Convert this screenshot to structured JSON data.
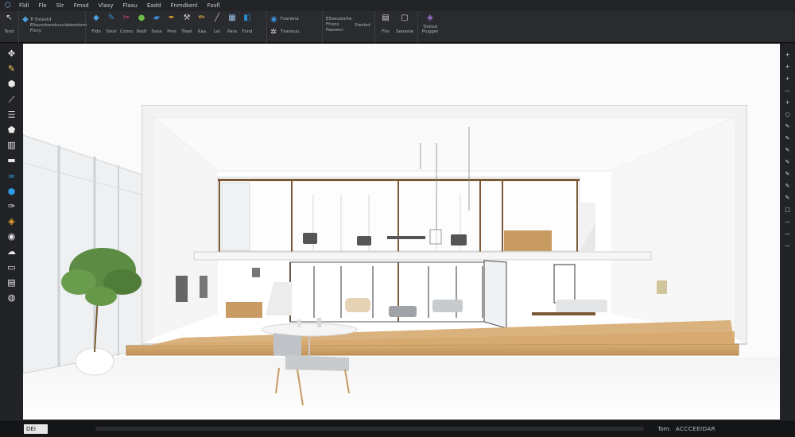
{
  "menu": {
    "items": [
      "Fldl",
      "Fle",
      "Str",
      "Fmsd",
      "Vlasy",
      "Flasu",
      "Eadd",
      "Fnmdkenl",
      "Fosfl"
    ]
  },
  "ribbon": {
    "group1": {
      "label": "Tsnd"
    },
    "group2": {
      "lines": [
        "Tr Exlestd",
        "Ellsunrbaretunulatenstorn",
        "Flsny"
      ]
    },
    "tools": [
      {
        "label": "Fldo",
        "icon": "cube-icon",
        "glyph": "◆",
        "color": "#4aa3df"
      },
      {
        "label": "Sleol",
        "icon": "pencil-icon",
        "glyph": "✎",
        "color": "#2d8fd5"
      },
      {
        "label": "Como",
        "icon": "scissors-icon",
        "glyph": "✂",
        "color": "#d34b7a"
      },
      {
        "label": "Nodl",
        "icon": "circle-icon",
        "glyph": "●",
        "color": "#6cc04a"
      },
      {
        "label": "Sosa",
        "icon": "paint-icon",
        "glyph": "▰",
        "color": "#3c8ad8"
      },
      {
        "label": "Pres",
        "icon": "pen-icon",
        "glyph": "✒",
        "color": "#d89c2e"
      },
      {
        "label": "Treat",
        "icon": "wrench-icon",
        "glyph": "⚒",
        "color": "#cfcfcf"
      },
      {
        "label": "Kaa",
        "icon": "brush-icon",
        "glyph": "✏",
        "color": "#f0b84a"
      },
      {
        "label": "Lel",
        "icon": "line-icon",
        "glyph": "╱",
        "color": "#bbbbbb"
      },
      {
        "label": "Para",
        "icon": "grid-icon",
        "glyph": "▦",
        "color": "#9ac3e8"
      },
      {
        "label": "Fsnd",
        "icon": "layers-icon",
        "glyph": "◧",
        "color": "#2a8fd6"
      }
    ],
    "group4": {
      "icon1": "globe-icon",
      "icon2": "settings-icon",
      "label1": "Fsarwna",
      "label2": "Txarwuu"
    },
    "group5": {
      "lines": [
        "Ellaeuwarte",
        "Fhons",
        "Faaoeur"
      ],
      "side": "Pwnlsd"
    },
    "group6": [
      {
        "label": "Fliv",
        "icon": "save-icon",
        "glyph": "▤"
      },
      {
        "label": "Seoaste",
        "icon": "document-icon",
        "glyph": "▢"
      }
    ],
    "group7": {
      "lines": [
        "Tootsd",
        "Plugger"
      ],
      "icon": "plugin-icon"
    }
  },
  "left_tools": [
    {
      "name": "move-tool-icon",
      "glyph": "✥",
      "color": "#e8e8e8"
    },
    {
      "name": "pencil-tool-icon",
      "glyph": "✎",
      "color": "#f0d060"
    },
    {
      "name": "eraser-tool-icon",
      "glyph": "⬢",
      "color": "#e8e8e8"
    },
    {
      "name": "knife-tool-icon",
      "glyph": "⟋",
      "color": "#e8e8e8"
    },
    {
      "name": "stack-tool-icon",
      "glyph": "☰",
      "color": "#e8e8e8"
    },
    {
      "name": "shield-tool-icon",
      "glyph": "⬟",
      "color": "#e8e8e8"
    },
    {
      "name": "columns-tool-icon",
      "glyph": "▥",
      "color": "#e8e8e8"
    },
    {
      "name": "tape-tool-icon",
      "glyph": "▬",
      "color": "#e8e8e8"
    },
    {
      "name": "link-tool-icon",
      "glyph": "∞",
      "color": "#2c9be8"
    },
    {
      "name": "sphere-tool-icon",
      "glyph": "●",
      "color": "#2c9be8"
    },
    {
      "name": "paint-tool-icon",
      "glyph": "✑",
      "color": "#e8e8e8"
    },
    {
      "name": "bucket-tool-icon",
      "glyph": "◈",
      "color": "#f0a030"
    },
    {
      "name": "swatch-tool-icon",
      "glyph": "◉",
      "color": "#e8e8e8"
    },
    {
      "name": "cloud-tool-icon",
      "glyph": "☁",
      "color": "#e8e8e8"
    },
    {
      "name": "tag-tool-icon",
      "glyph": "▭",
      "color": "#e8e8e8"
    },
    {
      "name": "section-tool-icon",
      "glyph": "▤",
      "color": "#e8e8e8"
    },
    {
      "name": "globe-tool-icon",
      "glyph": "◍",
      "color": "#e8e8e8"
    }
  ],
  "right_tools": [
    "plus-icon",
    "plus-icon",
    "plus-icon",
    "line-icon",
    "plus-icon",
    "circle-icon",
    "pencil-icon",
    "pencil-icon",
    "pencil-icon",
    "pencil-icon",
    "pencil-icon",
    "pencil-icon",
    "pencil-icon",
    "square-icon",
    "line-icon",
    "line-icon",
    "line-icon"
  ],
  "colors": {
    "wood": "#c79b62",
    "wood_edge": "#b38752",
    "frame": "#7a5a36",
    "glass": "#eef1f4",
    "plant": "#5c8c43",
    "chair": "#bfc2c6"
  },
  "status": {
    "coord_value": "DEI",
    "label": "Tom:",
    "value": "ACCCEEIDAR"
  }
}
